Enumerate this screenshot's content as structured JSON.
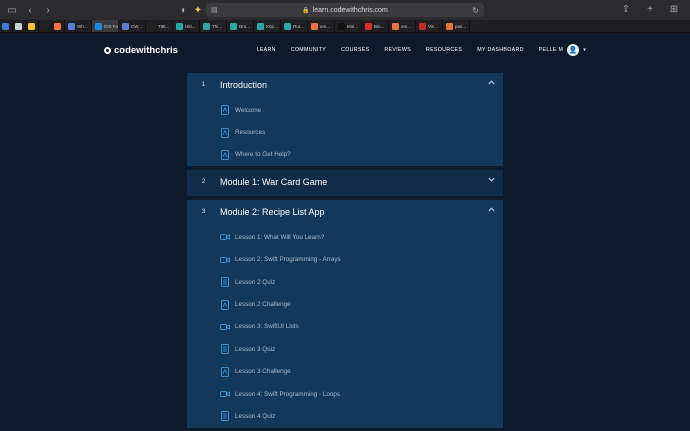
{
  "browser": {
    "url": "learn.codewithchris.com",
    "tabs": [
      {
        "label": "",
        "color": "#3b7bd6",
        "size": "sm"
      },
      {
        "label": "",
        "color": "#c8d0d8",
        "size": "sm"
      },
      {
        "label": "",
        "color": "#f0c040",
        "size": "sm"
      },
      {
        "label": "",
        "color": "#222222",
        "size": "sm"
      },
      {
        "label": "",
        "color": "#ff7043",
        "size": "sm"
      },
      {
        "label": "Wh...",
        "color": "#5b7bd5",
        "size": "lg"
      },
      {
        "label": "iOS Fou...",
        "color": "#1e88e5",
        "size": "lg",
        "active": true
      },
      {
        "label": "CW...",
        "color": "#5b7bd5",
        "size": "lg"
      },
      {
        "label": "Tält...",
        "color": "#222222",
        "size": "lg"
      },
      {
        "label": "Hitt...",
        "color": "#2aa6a6",
        "size": "lg"
      },
      {
        "label": "Thi...",
        "color": "#2aa6a6",
        "size": "lg"
      },
      {
        "label": "Dro...",
        "color": "#2aa6a6",
        "size": "lg"
      },
      {
        "label": "Köp...",
        "color": "#2aa6a6",
        "size": "lg"
      },
      {
        "label": "Rut...",
        "color": "#2aa6a6",
        "size": "lg"
      },
      {
        "label": "em...",
        "color": "#e8743b",
        "size": "lg"
      },
      {
        "label": "Mol...",
        "color": "#111111",
        "size": "lg"
      },
      {
        "label": "Bin...",
        "color": "#d32f2f",
        "size": "lg"
      },
      {
        "label": "em...",
        "color": "#e8743b",
        "size": "lg"
      },
      {
        "label": "Vis...",
        "color": "#c62828",
        "size": "lg"
      },
      {
        "label": "pas...",
        "color": "#e8743b",
        "size": "lg"
      }
    ]
  },
  "header": {
    "logo": "codewithchris",
    "nav": [
      "LEARN",
      "COMMUNITY",
      "COURSES",
      "REVIEWS",
      "RESOURCES",
      "MY DASHBOARD"
    ],
    "user_name": "PELLE M"
  },
  "sections": [
    {
      "num": "1",
      "title": "Introduction",
      "expanded": true,
      "lessons": [
        {
          "label": "Welcome",
          "type": "document"
        },
        {
          "label": "Resources",
          "type": "document"
        },
        {
          "label": "Where to Get Help?",
          "type": "document"
        }
      ]
    },
    {
      "num": "2",
      "title": "Module 1: War Card Game",
      "expanded": false,
      "lessons": []
    },
    {
      "num": "3",
      "title": "Module 2: Recipe List App",
      "expanded": true,
      "lessons": [
        {
          "label": "Lesson 1: What Will You Learn?",
          "type": "video"
        },
        {
          "label": "Lesson 2: Swift Programming - Arrays",
          "type": "video"
        },
        {
          "label": "Lesson 2 Quiz",
          "type": "quiz"
        },
        {
          "label": "Lesson 2 Challenge",
          "type": "document"
        },
        {
          "label": "Lesson 3: SwiftUI Lists",
          "type": "video"
        },
        {
          "label": "Lesson 3 Quiz",
          "type": "quiz"
        },
        {
          "label": "Lesson 3 Challenge",
          "type": "document"
        },
        {
          "label": "Lesson 4: Swift Programming - Loops",
          "type": "video"
        },
        {
          "label": "Lesson 4 Quiz",
          "type": "quiz"
        }
      ]
    }
  ],
  "colors": {
    "accent": "#4aa3ef",
    "background": "#0d1a2c",
    "section": "#14385a"
  }
}
